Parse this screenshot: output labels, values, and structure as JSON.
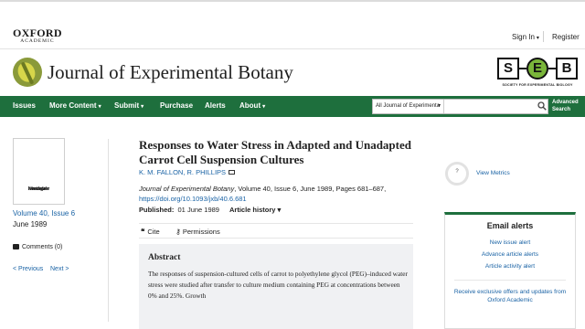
{
  "header": {
    "publisher_name": "OXFORD",
    "publisher_sub": "ACADEMIC",
    "sign_in": "Sign In",
    "register": "Register"
  },
  "journal": {
    "title": "Journal of Experimental Botany",
    "society_letters": [
      "S",
      "E",
      "B"
    ],
    "society_caption": "SOCIETY FOR EXPERIMENTAL BIOLOGY"
  },
  "nav": {
    "items": [
      {
        "label": "Issues",
        "dropdown": false
      },
      {
        "label": "More Content",
        "dropdown": true
      },
      {
        "label": "Submit",
        "dropdown": true
      },
      {
        "label": "Purchase",
        "dropdown": false
      },
      {
        "label": "Alerts",
        "dropdown": false
      },
      {
        "label": "About",
        "dropdown": true
      }
    ],
    "search_scope": "All Journal of Experimenta",
    "search_placeholder": "",
    "advanced_line1": "Advanced",
    "advanced_line2": "Search",
    "color": "#1e6f3d"
  },
  "left_rail": {
    "cover_text_1": "No cover",
    "cover_text_2": "image",
    "cover_text_3": "available",
    "volume_issue": "Volume 40, Issue 6",
    "issue_date": "June 1989",
    "comments": "Comments (0)",
    "prev": "< Previous",
    "next": "Next >"
  },
  "article": {
    "title": "Responses to Water Stress in Adapted and Unadapted Carrot Cell Suspension Cultures",
    "authors": "K. M. FALLON, R. PHILLIPS",
    "journal_name": "Journal of Experimental Botany",
    "citation_rest": ", Volume 40, Issue 6, June 1989, Pages 681–687,",
    "doi": "https://doi.org/10.1093/jxb/40.6.681",
    "published_label": "Published:",
    "published_date": "01 June 1989",
    "history_label": "Article history",
    "cite_label": "Cite",
    "permissions_label": "Permissions",
    "abstract_heading": "Abstract",
    "abstract_text": "The responses of suspension-cultured cells of carrot to polyethylene glycol (PEG)–induced water stress were studied after transfer to culture medium containing PEG at concentrations between 0% and 25%. Growth"
  },
  "right_rail": {
    "metrics_badge": "?",
    "view_metrics": "View Metrics",
    "email_alerts_title": "Email alerts",
    "alert_links": [
      "New issue alert",
      "Advance article alerts",
      "Article activity alert"
    ],
    "offers_text": "Receive exclusive offers and updates from Oxford Academic"
  }
}
